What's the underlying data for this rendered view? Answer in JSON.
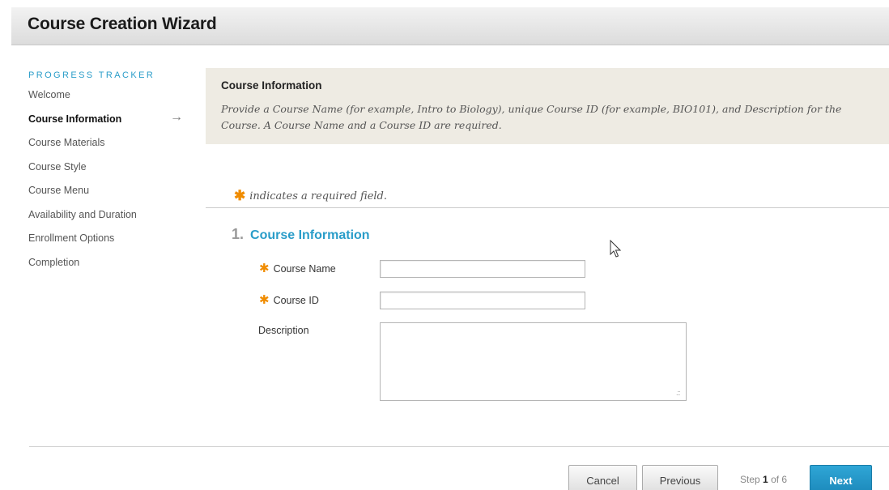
{
  "header": {
    "title": "Course Creation Wizard"
  },
  "tracker": {
    "heading": "PROGRESS TRACKER",
    "items": [
      {
        "label": "Welcome"
      },
      {
        "label": "Course Information"
      },
      {
        "label": "Course Materials"
      },
      {
        "label": "Course Style"
      },
      {
        "label": "Course Menu"
      },
      {
        "label": "Availability and Duration"
      },
      {
        "label": "Enrollment Options"
      },
      {
        "label": "Completion"
      }
    ],
    "active_index": 1,
    "arrow": "→"
  },
  "info": {
    "title": "Course Information",
    "text": "Provide a Course Name (for example, Intro to Biology), unique Course ID (for example, BIO101), and Description for the Course. A Course Name and a Course ID are required."
  },
  "required_note": "indicates a required field.",
  "required_symbol": "✱",
  "section": {
    "number": "1.",
    "title": "Course Information"
  },
  "fields": {
    "course_name": {
      "label": "Course Name",
      "value": ""
    },
    "course_id": {
      "label": "Course ID",
      "value": ""
    },
    "description": {
      "label": "Description",
      "value": ""
    }
  },
  "footer": {
    "cancel_label": "Cancel",
    "previous_label": "Previous",
    "step_prefix": "Step",
    "step_current": "1",
    "step_of": "of",
    "step_total": "6",
    "next_label": "Next"
  },
  "icons": {
    "required": "asterisk-icon",
    "cursor": "mouse-pointer-icon",
    "resize": "resize-grip-icon"
  },
  "colors": {
    "accent": "#2a9dc9",
    "required": "#f08c00",
    "info_bg": "#eeebe3",
    "next_button": "#1c89bb"
  }
}
